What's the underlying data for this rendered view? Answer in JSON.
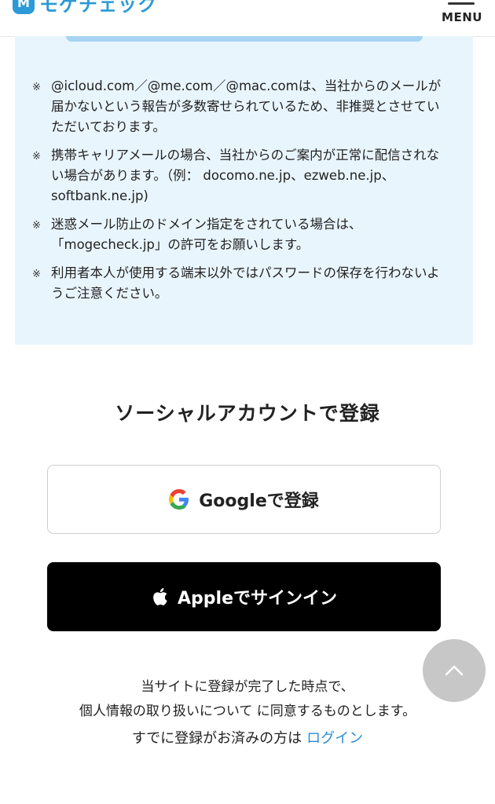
{
  "header": {
    "logo_mark": "M",
    "logo_text": "モゲチェック",
    "menu_label": "MENU"
  },
  "notice": {
    "mark": "※",
    "items": [
      "@icloud.com／@me.com／@mac.comは、当社からのメールが届かないという報告が多数寄せられているため、非推奨とさせていただいております。",
      "携帯キャリアメールの場合、当社からのご案内が正常に配信されない場合があります。（例： docomo.ne.jp、ezweb.ne.jp、softbank.ne.jp)",
      "迷惑メール防止のドメイン指定をされている場合は、「mogecheck.jp」の許可をお願いします。",
      "利用者本人が使用する端末以外ではパスワードの保存を行わないようご注意ください。"
    ]
  },
  "social": {
    "title": "ソーシャルアカウントで登録",
    "google_label": "Googleで登録",
    "apple_label": "Appleでサインイン"
  },
  "consent": {
    "line1": "当サイトに登録が完了した時点で、",
    "line2": "個人情報の取り扱いについて に同意するものとします。"
  },
  "login": {
    "prefix": "すでに登録がお済みの方は",
    "link": "ログイン"
  },
  "colors": {
    "brand": "#2b9ad6",
    "notice_bg": "#e9f5fd",
    "link": "#2a8ed6",
    "apple_bg": "#000000"
  }
}
